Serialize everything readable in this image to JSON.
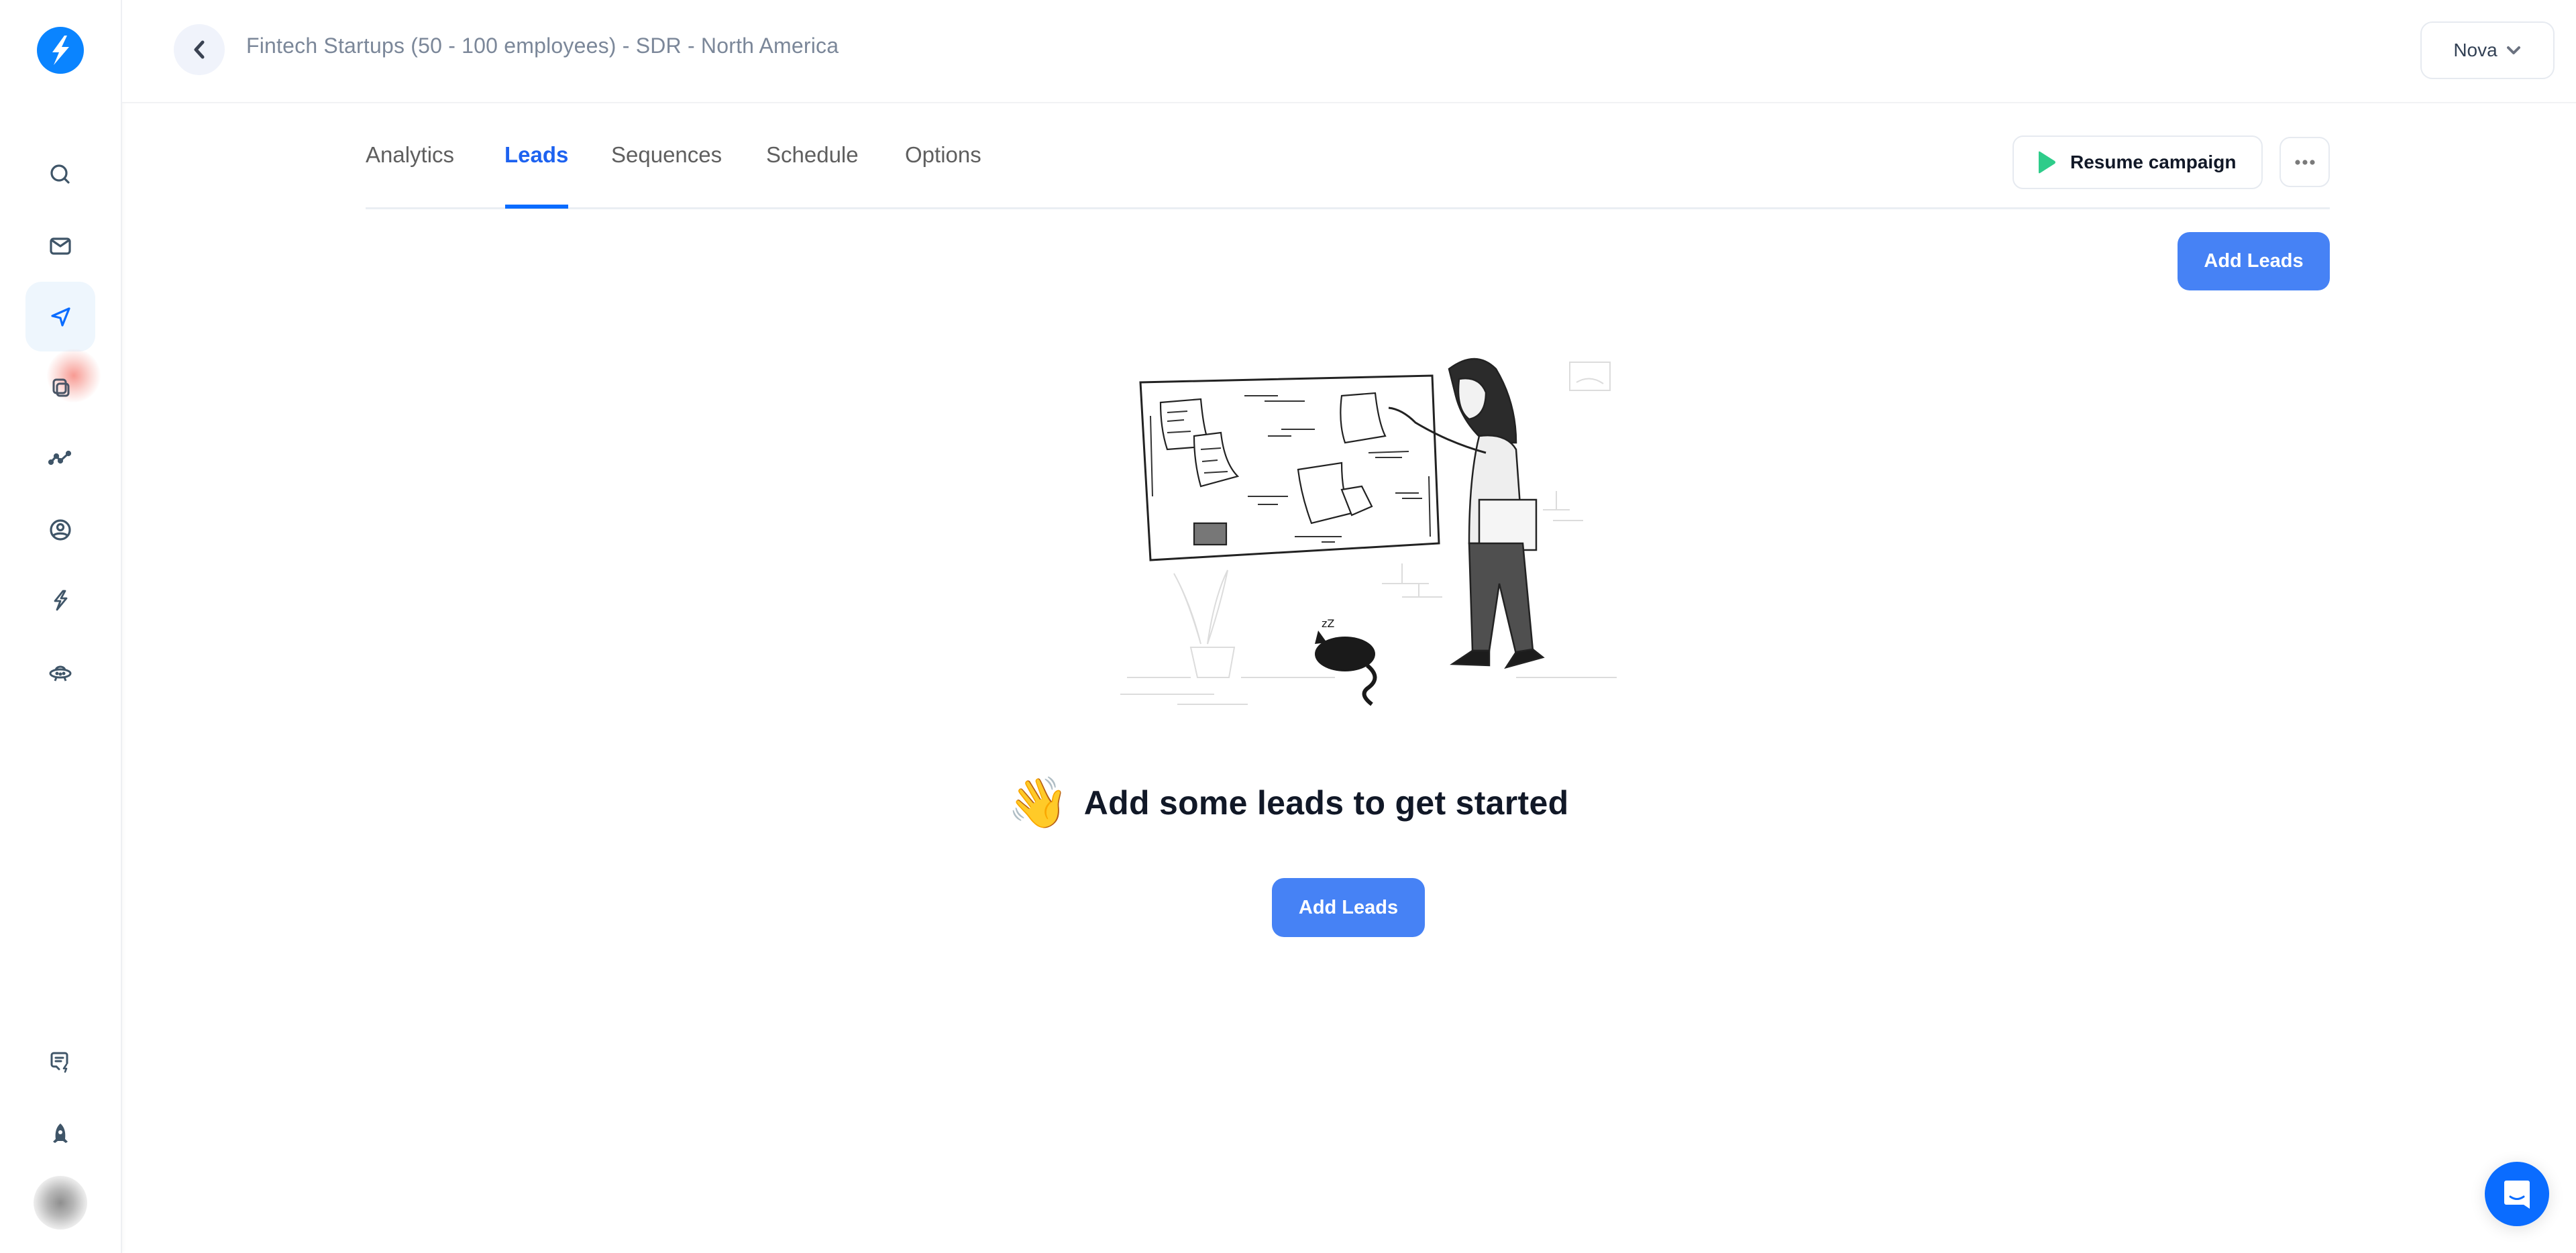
{
  "app": {
    "logo_icon": "lightning-bolt-logo",
    "brand_color": "#0a84ff",
    "accent_color": "#4682f5"
  },
  "sidebar": {
    "items": [
      {
        "id": "search",
        "icon": "search-icon",
        "active": false
      },
      {
        "id": "inbox",
        "icon": "mail-icon",
        "active": false
      },
      {
        "id": "campaigns",
        "icon": "send-icon",
        "active": true
      },
      {
        "id": "templates",
        "icon": "copy-icon",
        "active": false
      },
      {
        "id": "analytics",
        "icon": "trend-line-icon",
        "active": false
      },
      {
        "id": "contacts",
        "icon": "user-circle-icon",
        "active": false
      },
      {
        "id": "automations",
        "icon": "bolt-icon",
        "active": false
      },
      {
        "id": "integrations",
        "icon": "ufo-icon",
        "active": false
      }
    ],
    "bottom_items": [
      {
        "id": "feedback",
        "icon": "chat-bolt-icon"
      },
      {
        "id": "whats-new",
        "icon": "rocket-icon"
      },
      {
        "id": "profile",
        "icon": "avatar"
      }
    ]
  },
  "header": {
    "back_icon": "chevron-left-icon",
    "title": "Fintech Startups (50 - 100 employees) - SDR - North America",
    "workspace": {
      "label": "Nova",
      "icon": "chevron-down-icon"
    }
  },
  "tabs": [
    {
      "label": "Analytics",
      "active": false
    },
    {
      "label": "Leads",
      "active": true
    },
    {
      "label": "Sequences",
      "active": false
    },
    {
      "label": "Schedule",
      "active": false
    },
    {
      "label": "Options",
      "active": false
    }
  ],
  "toolbar": {
    "resume_label": "Resume campaign",
    "resume_icon": "play-icon",
    "resume_icon_color": "#2ecc8a",
    "more_icon": "more-horizontal-icon",
    "add_leads_label": "Add Leads"
  },
  "empty_state": {
    "emoji": "👋",
    "title": "Add some leads to get started",
    "button_label": "Add Leads",
    "illustration": "woman-pinning-notes-to-board-with-sleeping-cat"
  },
  "chat_launcher": {
    "icon": "chat-smile-icon"
  }
}
